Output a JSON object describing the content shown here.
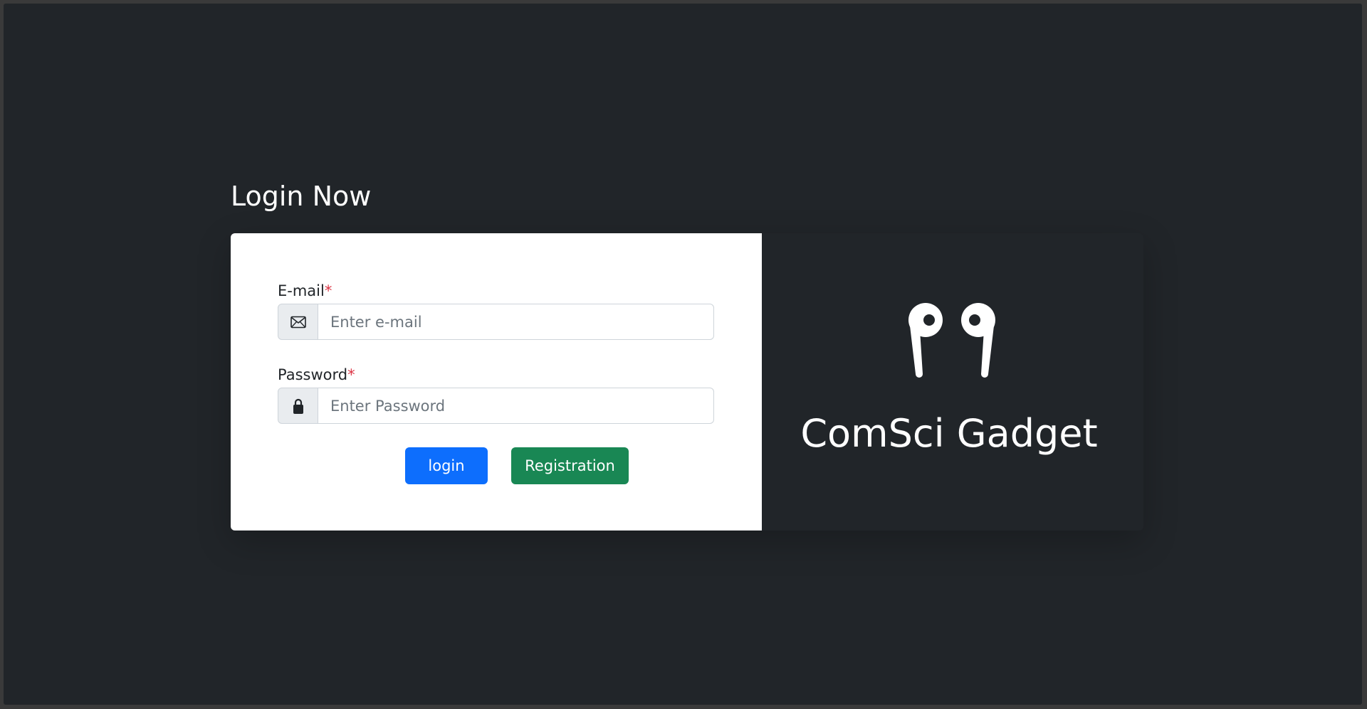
{
  "page": {
    "title": "Login Now"
  },
  "form": {
    "email": {
      "label": "E-mail",
      "required_mark": "*",
      "placeholder": "Enter e-mail",
      "icon": "envelope-icon"
    },
    "password": {
      "label": "Password",
      "required_mark": "*",
      "placeholder": "Enter Password",
      "icon": "lock-icon"
    },
    "login_label": "login",
    "registration_label": "Registration"
  },
  "brand": {
    "name": "ComSci Gadget",
    "logo_icon": "earbuds-icon"
  },
  "colors": {
    "background": "#212529",
    "primary": "#0d6efd",
    "success": "#198754",
    "required": "#dc3545"
  }
}
